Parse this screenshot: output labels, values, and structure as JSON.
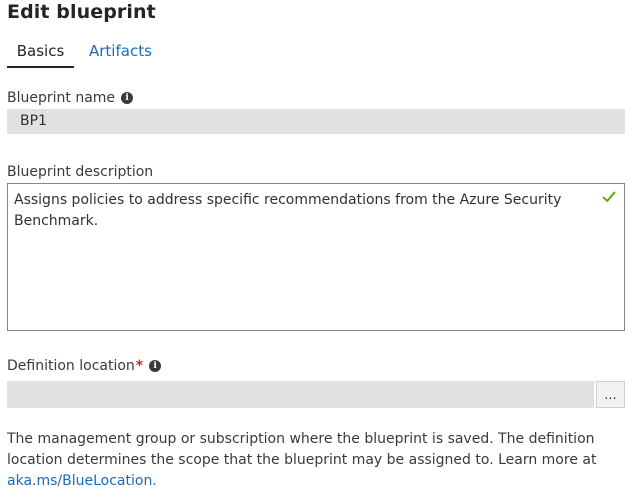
{
  "page": {
    "title": "Edit blueprint"
  },
  "tabs": [
    {
      "label": "Basics",
      "active": true
    },
    {
      "label": "Artifacts",
      "active": false
    }
  ],
  "blueprint_name": {
    "label": "Blueprint name",
    "value": "BP1",
    "info_icon": "info-icon"
  },
  "blueprint_description": {
    "label": "Blueprint description",
    "value": "Assigns policies to address specific recommendations from the Azure Security Benchmark.",
    "valid_icon": "checkmark-icon",
    "valid_color": "#57a300"
  },
  "definition_location": {
    "label": "Definition location",
    "required_marker": "*",
    "info_icon": "info-icon",
    "value": "",
    "browse_button_label": "...",
    "help_text": "The management group or subscription where the blueprint is saved. The definition location determines the scope that the blueprint may be assigned to. Learn more at ",
    "help_link": "aka.ms/BlueLocation."
  },
  "colors": {
    "link": "#1a6bb8",
    "required": "#c4262e",
    "readonly_background": "#e1e1e1"
  }
}
